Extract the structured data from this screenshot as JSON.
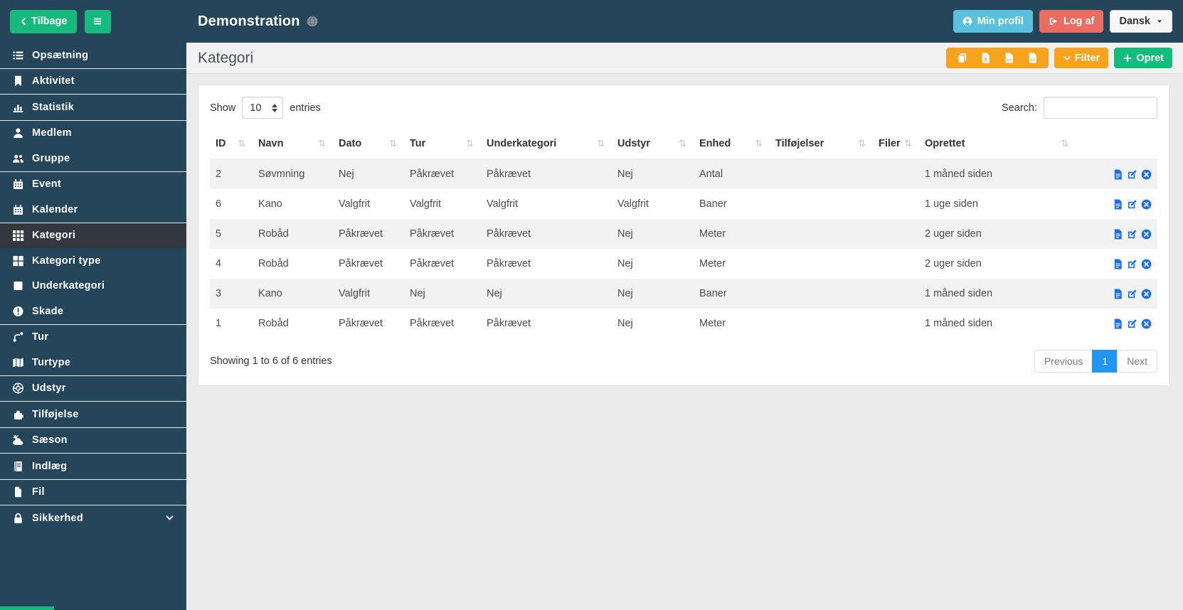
{
  "chrome": {
    "back_label": "Tilbage",
    "title": "Demonstration",
    "profile_label": "Min profil",
    "logout_label": "Log af",
    "language_label": "Dansk"
  },
  "sidebar": {
    "groups": [
      [
        {
          "label": "Opsætning",
          "icon": "list"
        }
      ],
      [
        {
          "label": "Aktivitet",
          "icon": "bookmark"
        }
      ],
      [
        {
          "label": "Statistik",
          "icon": "bar-chart"
        }
      ],
      [
        {
          "label": "Medlem",
          "icon": "user"
        },
        {
          "label": "Gruppe",
          "icon": "users"
        }
      ],
      [
        {
          "label": "Event",
          "icon": "calendar"
        },
        {
          "label": "Kalender",
          "icon": "calendar"
        }
      ],
      [
        {
          "label": "Kategori",
          "icon": "grid",
          "active": true
        },
        {
          "label": "Kategori type",
          "icon": "grid-large"
        },
        {
          "label": "Underkategori",
          "icon": "square"
        },
        {
          "label": "Skade",
          "icon": "exclamation-circle"
        }
      ],
      [
        {
          "label": "Tur",
          "icon": "route"
        },
        {
          "label": "Turtype",
          "icon": "map"
        }
      ],
      [
        {
          "label": "Udstyr",
          "icon": "life-ring"
        }
      ],
      [
        {
          "label": "Tilføjelse",
          "icon": "puzzle"
        }
      ],
      [
        {
          "label": "Sæson",
          "icon": "cloud-sun"
        }
      ],
      [
        {
          "label": "Indlæg",
          "icon": "journal"
        }
      ],
      [
        {
          "label": "Fil",
          "icon": "file"
        }
      ],
      [
        {
          "label": "Sikkerhed",
          "icon": "lock",
          "caret": true
        }
      ]
    ]
  },
  "page": {
    "title": "Kategori"
  },
  "toolbar": {
    "export_buttons": [
      "copy",
      "excel",
      "csv",
      "pdf"
    ],
    "filter_label": "Filter",
    "create_label": "Opret"
  },
  "table": {
    "controls": {
      "show_label": "Show",
      "page_size": "10",
      "entries_label": "entries",
      "search_label": "Search:",
      "search_value": ""
    },
    "columns": [
      "ID",
      "Navn",
      "Dato",
      "Tur",
      "Underkategori",
      "Udstyr",
      "Enhed",
      "Tilføjelser",
      "Filer",
      "Oprettet",
      ""
    ],
    "rows": [
      [
        "2",
        "Søvmning",
        "Nej",
        "Påkrævet",
        "Påkrævet",
        "Nej",
        "Antal",
        "",
        "",
        "1 måned siden"
      ],
      [
        "6",
        "Kano",
        "Valgfrit",
        "Valgfrit",
        "Valgfrit",
        "Valgfrit",
        "Baner",
        "",
        "",
        "1 uge siden"
      ],
      [
        "5",
        "Robåd",
        "Påkrævet",
        "Påkrævet",
        "Påkrævet",
        "Nej",
        "Meter",
        "",
        "",
        "2 uger siden"
      ],
      [
        "4",
        "Robåd",
        "Påkrævet",
        "Påkrævet",
        "Påkrævet",
        "Nej",
        "Meter",
        "",
        "",
        "2 uger siden"
      ],
      [
        "3",
        "Kano",
        "Valgfrit",
        "Nej",
        "Nej",
        "Nej",
        "Baner",
        "",
        "",
        "1 måned siden"
      ],
      [
        "1",
        "Robåd",
        "Påkrævet",
        "Påkrævet",
        "Påkrævet",
        "Nej",
        "Meter",
        "",
        "",
        "1 måned siden"
      ]
    ],
    "row_actions": [
      {
        "name": "details",
        "icon": "file-text"
      },
      {
        "name": "edit",
        "icon": "edit"
      },
      {
        "name": "delete",
        "icon": "times-circle"
      }
    ],
    "footer": {
      "summary": "Showing 1 to 6 of 6 entries",
      "previous_label": "Previous",
      "page": "1",
      "next_label": "Next"
    }
  },
  "colors": {
    "header_bg": "#24455a",
    "sidebar_active_bg": "#33383e",
    "green": "#17b97d",
    "info_blue": "#5bc0de",
    "danger_red": "#ea6c62",
    "orange": "#f8a31d",
    "action_blue": "#1a6ef3",
    "active_page_blue": "#2196f3"
  }
}
